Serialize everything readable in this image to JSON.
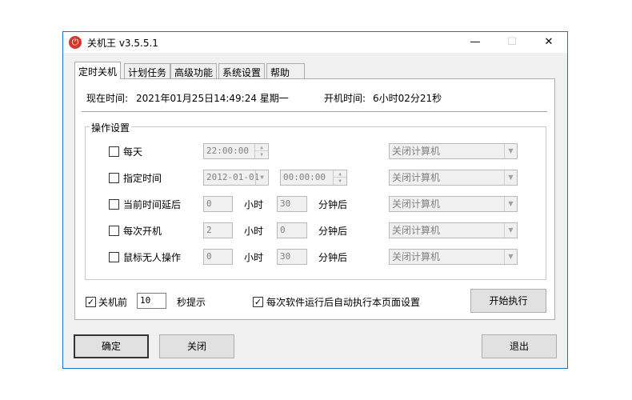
{
  "window": {
    "title": "关机王 v3.5.5.1",
    "controls": {
      "minimize": "—",
      "maximize": "☐",
      "close": "✕"
    }
  },
  "tabs": [
    {
      "label": "定时关机",
      "active": true
    },
    {
      "label": "计划任务",
      "active": false
    },
    {
      "label": "高级功能",
      "active": false
    },
    {
      "label": "系统设置",
      "active": false
    },
    {
      "label": "帮助",
      "active": false
    }
  ],
  "status": {
    "now_label": "现在时间:",
    "now_value": "2021年01月25日14:49:24 星期一",
    "uptime_label": "开机时间:",
    "uptime_value": "6小时02分21秒"
  },
  "operations": {
    "group_title": "操作设置",
    "rows": [
      {
        "label": "每天",
        "checked": false,
        "time": "22:00:00",
        "action": "关闭计算机"
      },
      {
        "label": "指定时间",
        "checked": false,
        "date": "2012-01-01",
        "time": "00:00:00",
        "action": "关闭计算机"
      },
      {
        "label": "当前时间延后",
        "checked": false,
        "hours": "0",
        "hours_unit": "小时",
        "minutes": "30",
        "minutes_unit": "分钟后",
        "action": "关闭计算机"
      },
      {
        "label": "每次开机",
        "checked": false,
        "hours": "2",
        "hours_unit": "小时",
        "minutes": "0",
        "minutes_unit": "分钟后",
        "action": "关闭计算机"
      },
      {
        "label": "鼠标无人操作",
        "checked": false,
        "hours": "0",
        "hours_unit": "小时",
        "minutes": "30",
        "minutes_unit": "分钟后",
        "action": "关闭计算机"
      }
    ]
  },
  "options": {
    "before_label": "关机前",
    "before_checked": true,
    "before_seconds": "10",
    "before_suffix": "秒提示",
    "autorun_label": "每次软件运行后自动执行本页面设置",
    "autorun_checked": true,
    "start_button": "开始执行"
  },
  "footer": {
    "ok_button": "确定",
    "close_button": "关闭",
    "exit_button": "退出"
  }
}
